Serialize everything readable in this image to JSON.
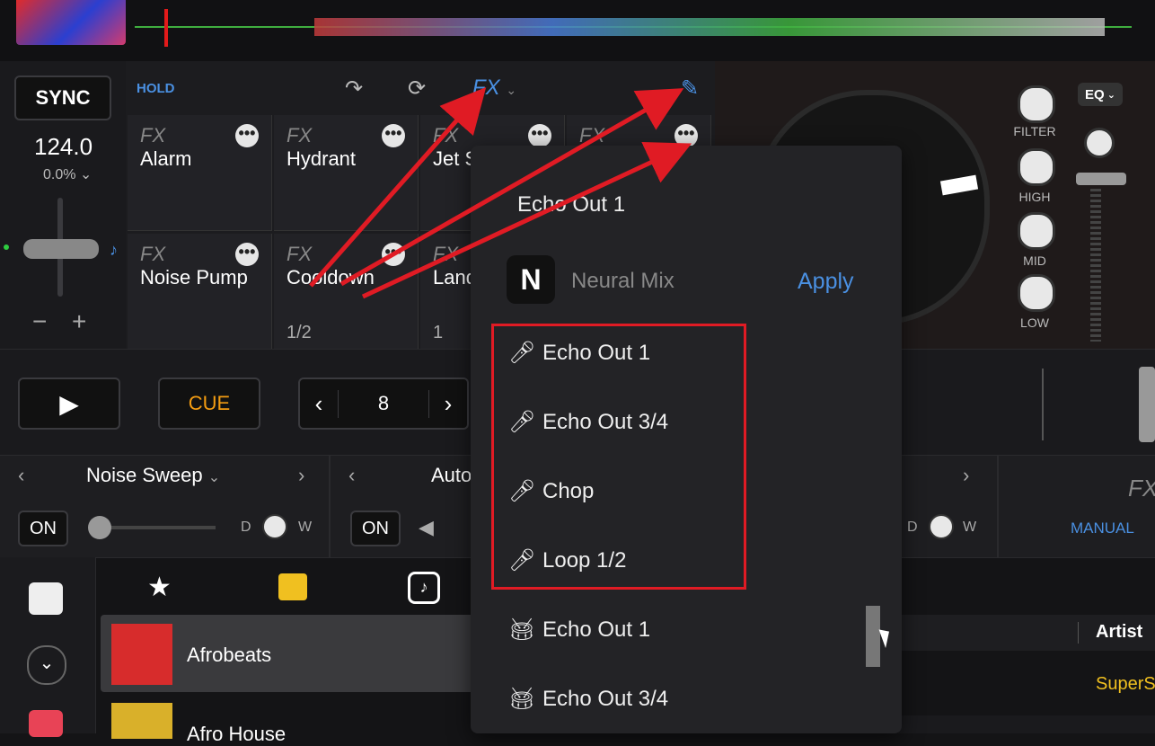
{
  "deck_left": {
    "sync_label": "SYNC",
    "bpm": "124.0",
    "pitch": "0.0%",
    "pitch_chevron": "chevron-down-icon",
    "minus": "−",
    "plus": "+"
  },
  "fx_panel": {
    "hold_label": "HOLD",
    "fx_tab_label": "FX",
    "icons": [
      "redo-arrow-icon",
      "loop-icon",
      "pencil-icon"
    ],
    "cells": [
      {
        "tag": "FX",
        "name": "Alarm",
        "beat": ""
      },
      {
        "tag": "FX",
        "name": "Hydrant",
        "beat": ""
      },
      {
        "tag": "FX",
        "name": "Jet S",
        "beat": ""
      },
      {
        "tag": "FX",
        "name": "",
        "beat": ""
      },
      {
        "tag": "FX",
        "name": "Noise Pump",
        "beat": ""
      },
      {
        "tag": "FX",
        "name": "Cooldown",
        "beat": "1/2"
      },
      {
        "tag": "FX",
        "name": "Land",
        "beat": "1"
      }
    ],
    "dots": "•••"
  },
  "deck_right": {
    "eq_label": "EQ",
    "knobs": [
      "FILTER",
      "HIGH",
      "MID",
      "LOW"
    ]
  },
  "transport": {
    "cue_label": "CUE",
    "loop_value": "8",
    "prev": "‹",
    "next": "›"
  },
  "fx_row": {
    "left_effect": "Noise Sweep",
    "middle_effect": "Auto",
    "on_label": "ON",
    "d_label": "D",
    "w_label": "W",
    "right_fx_tag": "FX",
    "manual_label": "MANUAL"
  },
  "library": {
    "playlists": [
      "Afrobeats",
      "Afro House"
    ],
    "column_header": "Artist",
    "artist_value": "SuperS"
  },
  "dropdown": {
    "header_item": "Echo Out 1",
    "neural_mix_label": "Neural Mix",
    "apply_label": "Apply",
    "vocal_items": [
      "Echo Out 1",
      "Echo Out 3/4",
      "Chop",
      "Loop 1/2"
    ],
    "drum_items": [
      "Echo Out 1",
      "Echo Out 3/4"
    ]
  },
  "colors": {
    "accent_blue": "#4a90e2",
    "cue_orange": "#f39c12",
    "highlight_red": "#e01b24",
    "artist_yellow": "#f0c020"
  }
}
